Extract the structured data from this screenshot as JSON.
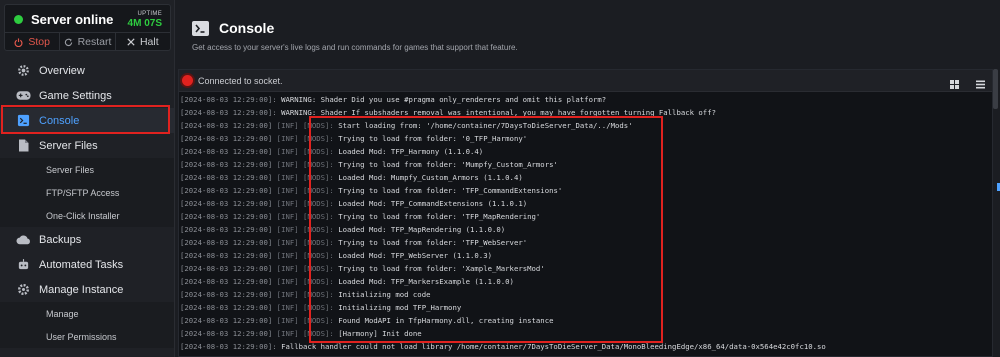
{
  "server": {
    "status": "Server online",
    "uptime_label": "UPTIME",
    "uptime_value": "4M 07S",
    "buttons": {
      "stop": "Stop",
      "restart": "Restart",
      "halt": "Halt"
    }
  },
  "nav": {
    "overview": "Overview",
    "game_settings": "Game Settings",
    "console": "Console",
    "server_files": "Server Files",
    "server_files_sub": [
      "Server Files",
      "FTP/SFTP Access",
      "One-Click Installer"
    ],
    "backups": "Backups",
    "automated_tasks": "Automated Tasks",
    "manage_instance": "Manage Instance",
    "manage_sub": [
      "Manage",
      "User Permissions"
    ]
  },
  "page": {
    "title": "Console",
    "subtitle": "Get access to your server's live logs and run commands for games that support that feature."
  },
  "console": {
    "socket_status": "Connected to socket.",
    "lines": [
      {
        "ts": "[2024-08-03 12:29:00]:",
        "tag": "",
        "mods": "",
        "msg": "WARNING: Shader Did you use #pragma only_renderers and omit this platform?"
      },
      {
        "ts": "[2024-08-03 12:29:00]:",
        "tag": "",
        "mods": "",
        "msg": "WARNING: Shader If subshaders removal was intentional, you may have forgotten turning Fallback off?"
      },
      {
        "ts": "[2024-08-03 12:29:00]",
        "tag": "[INF]",
        "mods": "[MODS]:",
        "msg": "Start loading from: '/home/container/7DaysToDieServer_Data/../Mods'"
      },
      {
        "ts": "[2024-08-03 12:29:00]",
        "tag": "[INF]",
        "mods": "[MODS]:",
        "msg": "Trying to load from folder: '0_TFP_Harmony'"
      },
      {
        "ts": "[2024-08-03 12:29:00]",
        "tag": "[INF]",
        "mods": "[MODS]:",
        "msg": "Loaded Mod: TFP_Harmony (1.1.0.4)"
      },
      {
        "ts": "[2024-08-03 12:29:00]",
        "tag": "[INF]",
        "mods": "[MODS]:",
        "msg": "Trying to load from folder: 'Mumpfy_Custom_Armors'"
      },
      {
        "ts": "[2024-08-03 12:29:00]",
        "tag": "[INF]",
        "mods": "[MODS]:",
        "msg": "Loaded Mod: Mumpfy_Custom_Armors (1.1.0.4)"
      },
      {
        "ts": "[2024-08-03 12:29:00]",
        "tag": "[INF]",
        "mods": "[MODS]:",
        "msg": "Trying to load from folder: 'TFP_CommandExtensions'"
      },
      {
        "ts": "[2024-08-03 12:29:00]",
        "tag": "[INF]",
        "mods": "[MODS]:",
        "msg": "Loaded Mod: TFP_CommandExtensions (1.1.0.1)"
      },
      {
        "ts": "[2024-08-03 12:29:00]",
        "tag": "[INF]",
        "mods": "[MODS]:",
        "msg": "Trying to load from folder: 'TFP_MapRendering'"
      },
      {
        "ts": "[2024-08-03 12:29:00]",
        "tag": "[INF]",
        "mods": "[MODS]:",
        "msg": "Loaded Mod: TFP_MapRendering (1.1.0.0)"
      },
      {
        "ts": "[2024-08-03 12:29:00]",
        "tag": "[INF]",
        "mods": "[MODS]:",
        "msg": "Trying to load from folder: 'TFP_WebServer'"
      },
      {
        "ts": "[2024-08-03 12:29:00]",
        "tag": "[INF]",
        "mods": "[MODS]:",
        "msg": "Loaded Mod: TFP_WebServer (1.1.0.3)"
      },
      {
        "ts": "[2024-08-03 12:29:00]",
        "tag": "[INF]",
        "mods": "[MODS]:",
        "msg": "Trying to load from folder: 'Xample_MarkersMod'"
      },
      {
        "ts": "[2024-08-03 12:29:00]",
        "tag": "[INF]",
        "mods": "[MODS]:",
        "msg": "Loaded Mod: TFP_MarkersExample (1.1.0.0)"
      },
      {
        "ts": "[2024-08-03 12:29:00]",
        "tag": "[INF]",
        "mods": "[MODS]:",
        "msg": "Initializing mod code"
      },
      {
        "ts": "[2024-08-03 12:29:00]",
        "tag": "[INF]",
        "mods": "[MODS]:",
        "msg": "Initializing mod TFP_Harmony"
      },
      {
        "ts": "[2024-08-03 12:29:00]",
        "tag": "[INF]",
        "mods": "[MODS]:",
        "msg": "Found ModAPI in TfpHarmony.dll, creating instance"
      },
      {
        "ts": "[2024-08-03 12:29:00]",
        "tag": "[INF]",
        "mods": "[MODS]:",
        "msg": "[Harmony] Init done"
      },
      {
        "ts": "[2024-08-03 12:29:00]:",
        "tag": "",
        "mods": "",
        "msg": "Fallback handler could not load library /home/container/7DaysToDieServer_Data/MonoBleedingEdge/x86_64/data-0x564e42c0fc10.so"
      }
    ]
  },
  "colors": {
    "accent": "#4ea1ff",
    "online": "#2ecc40",
    "danger": "#e0221f"
  }
}
